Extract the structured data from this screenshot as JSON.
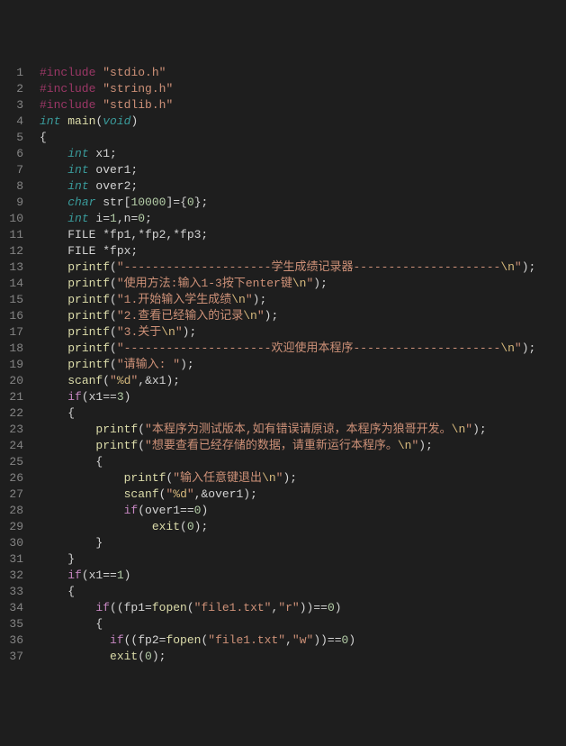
{
  "lines": [
    {
      "n": "1",
      "tokens": [
        [
          "kw-pre",
          "#include"
        ],
        [
          "op",
          " "
        ],
        [
          "str",
          "\"stdio.h\""
        ]
      ]
    },
    {
      "n": "2",
      "tokens": [
        [
          "kw-pre",
          "#include"
        ],
        [
          "op",
          " "
        ],
        [
          "str",
          "\"string.h\""
        ]
      ]
    },
    {
      "n": "3",
      "tokens": [
        [
          "kw-pre",
          "#include"
        ],
        [
          "op",
          " "
        ],
        [
          "str",
          "\"stdlib.h\""
        ]
      ]
    },
    {
      "n": "4",
      "tokens": [
        [
          "kw-type",
          "int"
        ],
        [
          "op",
          " "
        ],
        [
          "fn",
          "main"
        ],
        [
          "punct",
          "("
        ],
        [
          "kw-type",
          "void"
        ],
        [
          "punct",
          ")"
        ]
      ]
    },
    {
      "n": "5",
      "tokens": [
        [
          "punct",
          "{"
        ]
      ]
    },
    {
      "n": "6",
      "tokens": [
        [
          "op",
          "    "
        ],
        [
          "kw-type",
          "int"
        ],
        [
          "op",
          " x1;"
        ]
      ]
    },
    {
      "n": "7",
      "tokens": [
        [
          "op",
          "    "
        ],
        [
          "kw-type",
          "int"
        ],
        [
          "op",
          " over1;"
        ]
      ]
    },
    {
      "n": "8",
      "tokens": [
        [
          "op",
          "    "
        ],
        [
          "kw-type",
          "int"
        ],
        [
          "op",
          " over2;"
        ]
      ]
    },
    {
      "n": "9",
      "tokens": [
        [
          "op",
          "    "
        ],
        [
          "kw-type",
          "char"
        ],
        [
          "op",
          " str["
        ],
        [
          "num",
          "10000"
        ],
        [
          "op",
          "]={"
        ],
        [
          "num",
          "0"
        ],
        [
          "op",
          "};"
        ]
      ]
    },
    {
      "n": "10",
      "tokens": [
        [
          "op",
          "    "
        ],
        [
          "kw-type",
          "int"
        ],
        [
          "op",
          " i="
        ],
        [
          "num",
          "1"
        ],
        [
          "op",
          ",n="
        ],
        [
          "num",
          "0"
        ],
        [
          "op",
          ";"
        ]
      ]
    },
    {
      "n": "11",
      "tokens": [
        [
          "op",
          "    FILE *fp1,*fp2,*fp3;"
        ]
      ]
    },
    {
      "n": "12",
      "tokens": [
        [
          "op",
          "    FILE *fpx;"
        ]
      ]
    },
    {
      "n": "13",
      "tokens": [
        [
          "op",
          "    "
        ],
        [
          "fn",
          "printf"
        ],
        [
          "punct",
          "("
        ],
        [
          "str",
          "\"---------------------学生成绩记录器---------------------"
        ],
        [
          "esc",
          "\\n"
        ],
        [
          "str",
          "\""
        ],
        [
          "punct",
          ");"
        ]
      ]
    },
    {
      "n": "14",
      "tokens": [
        [
          "op",
          "    "
        ],
        [
          "fn",
          "printf"
        ],
        [
          "punct",
          "("
        ],
        [
          "str",
          "\"使用方法:输入1-3按下enter键"
        ],
        [
          "esc",
          "\\n"
        ],
        [
          "str",
          "\""
        ],
        [
          "punct",
          ");"
        ]
      ]
    },
    {
      "n": "15",
      "tokens": [
        [
          "op",
          "    "
        ],
        [
          "fn",
          "printf"
        ],
        [
          "punct",
          "("
        ],
        [
          "str",
          "\"1.开始输入学生成绩"
        ],
        [
          "esc",
          "\\n"
        ],
        [
          "str",
          "\""
        ],
        [
          "punct",
          ");"
        ]
      ]
    },
    {
      "n": "16",
      "tokens": [
        [
          "op",
          "    "
        ],
        [
          "fn",
          "printf"
        ],
        [
          "punct",
          "("
        ],
        [
          "str",
          "\"2.查看已经输入的记录"
        ],
        [
          "esc",
          "\\n"
        ],
        [
          "str",
          "\""
        ],
        [
          "punct",
          ");"
        ]
      ]
    },
    {
      "n": "17",
      "tokens": [
        [
          "op",
          "    "
        ],
        [
          "fn",
          "printf"
        ],
        [
          "punct",
          "("
        ],
        [
          "str",
          "\"3.关于"
        ],
        [
          "esc",
          "\\n"
        ],
        [
          "str",
          "\""
        ],
        [
          "punct",
          ");"
        ]
      ]
    },
    {
      "n": "18",
      "tokens": [
        [
          "op",
          "    "
        ],
        [
          "fn",
          "printf"
        ],
        [
          "punct",
          "("
        ],
        [
          "str",
          "\"---------------------欢迎使用本程序---------------------"
        ],
        [
          "esc",
          "\\n"
        ],
        [
          "str",
          "\""
        ],
        [
          "punct",
          ");"
        ]
      ]
    },
    {
      "n": "19",
      "tokens": [
        [
          "op",
          "    "
        ],
        [
          "fn",
          "printf"
        ],
        [
          "punct",
          "("
        ],
        [
          "str",
          "\"请输入: \""
        ],
        [
          "punct",
          ");"
        ]
      ]
    },
    {
      "n": "20",
      "tokens": [
        [
          "op",
          "    "
        ],
        [
          "fn",
          "scanf"
        ],
        [
          "punct",
          "("
        ],
        [
          "str",
          "\""
        ],
        [
          "cmt-hl",
          "%d"
        ],
        [
          "str",
          "\""
        ],
        [
          "op",
          ",&x1);"
        ]
      ]
    },
    {
      "n": "21",
      "tokens": [
        [
          "op",
          "    "
        ],
        [
          "kw-ctrl",
          "if"
        ],
        [
          "op",
          "(x1=="
        ],
        [
          "num",
          "3"
        ],
        [
          "op",
          ")"
        ]
      ]
    },
    {
      "n": "22",
      "tokens": [
        [
          "op",
          "    {"
        ]
      ]
    },
    {
      "n": "23",
      "tokens": [
        [
          "op",
          "        "
        ],
        [
          "fn",
          "printf"
        ],
        [
          "punct",
          "("
        ],
        [
          "str",
          "\"本程序为测试版本,如有错误请原谅，本程序为狼哥开发。"
        ],
        [
          "esc",
          "\\n"
        ],
        [
          "str",
          "\""
        ],
        [
          "punct",
          ");"
        ]
      ]
    },
    {
      "n": "24",
      "tokens": [
        [
          "op",
          "        "
        ],
        [
          "fn",
          "printf"
        ],
        [
          "punct",
          "("
        ],
        [
          "str",
          "\"想要查看已经存储的数据，请重新运行本程序。"
        ],
        [
          "esc",
          "\\n"
        ],
        [
          "str",
          "\""
        ],
        [
          "punct",
          ");"
        ]
      ]
    },
    {
      "n": "25",
      "tokens": [
        [
          "op",
          "        {"
        ]
      ]
    },
    {
      "n": "26",
      "tokens": [
        [
          "op",
          "            "
        ],
        [
          "fn",
          "printf"
        ],
        [
          "punct",
          "("
        ],
        [
          "str",
          "\"输入任意键退出"
        ],
        [
          "esc",
          "\\n"
        ],
        [
          "str",
          "\""
        ],
        [
          "punct",
          ");"
        ]
      ]
    },
    {
      "n": "27",
      "tokens": [
        [
          "op",
          "            "
        ],
        [
          "fn",
          "scanf"
        ],
        [
          "punct",
          "("
        ],
        [
          "str",
          "\""
        ],
        [
          "cmt-hl",
          "%d"
        ],
        [
          "str",
          "\""
        ],
        [
          "op",
          ",&over1);"
        ]
      ]
    },
    {
      "n": "28",
      "tokens": [
        [
          "op",
          "            "
        ],
        [
          "kw-ctrl",
          "if"
        ],
        [
          "op",
          "(over1=="
        ],
        [
          "num",
          "0"
        ],
        [
          "op",
          ")"
        ]
      ]
    },
    {
      "n": "29",
      "tokens": [
        [
          "op",
          "                "
        ],
        [
          "fn",
          "exit"
        ],
        [
          "punct",
          "("
        ],
        [
          "num",
          "0"
        ],
        [
          "punct",
          ");"
        ]
      ]
    },
    {
      "n": "30",
      "tokens": [
        [
          "op",
          "        }"
        ]
      ]
    },
    {
      "n": "31",
      "tokens": [
        [
          "op",
          "    }"
        ]
      ]
    },
    {
      "n": "32",
      "tokens": [
        [
          "op",
          "    "
        ],
        [
          "kw-ctrl",
          "if"
        ],
        [
          "op",
          "(x1=="
        ],
        [
          "num",
          "1"
        ],
        [
          "op",
          ")"
        ]
      ]
    },
    {
      "n": "33",
      "tokens": [
        [
          "op",
          "    {"
        ]
      ]
    },
    {
      "n": "34",
      "tokens": [
        [
          "op",
          "        "
        ],
        [
          "kw-ctrl",
          "if"
        ],
        [
          "op",
          "((fp1="
        ],
        [
          "fn",
          "fopen"
        ],
        [
          "punct",
          "("
        ],
        [
          "str",
          "\"file1.txt\""
        ],
        [
          "op",
          ","
        ],
        [
          "str",
          "\"r\""
        ],
        [
          "punct",
          "))=="
        ],
        [
          "num",
          "0"
        ],
        [
          "punct",
          ")"
        ]
      ]
    },
    {
      "n": "35",
      "tokens": [
        [
          "op",
          "        {"
        ]
      ]
    },
    {
      "n": "36",
      "tokens": [
        [
          "op",
          "          "
        ],
        [
          "kw-ctrl",
          "if"
        ],
        [
          "op",
          "((fp2="
        ],
        [
          "fn",
          "fopen"
        ],
        [
          "punct",
          "("
        ],
        [
          "str",
          "\"file1.txt\""
        ],
        [
          "op",
          ","
        ],
        [
          "str",
          "\"w\""
        ],
        [
          "punct",
          "))=="
        ],
        [
          "num",
          "0"
        ],
        [
          "punct",
          ")"
        ]
      ]
    },
    {
      "n": "37",
      "tokens": [
        [
          "op",
          "          "
        ],
        [
          "fn",
          "exit"
        ],
        [
          "punct",
          "("
        ],
        [
          "num",
          "0"
        ],
        [
          "punct",
          ");"
        ]
      ]
    }
  ]
}
